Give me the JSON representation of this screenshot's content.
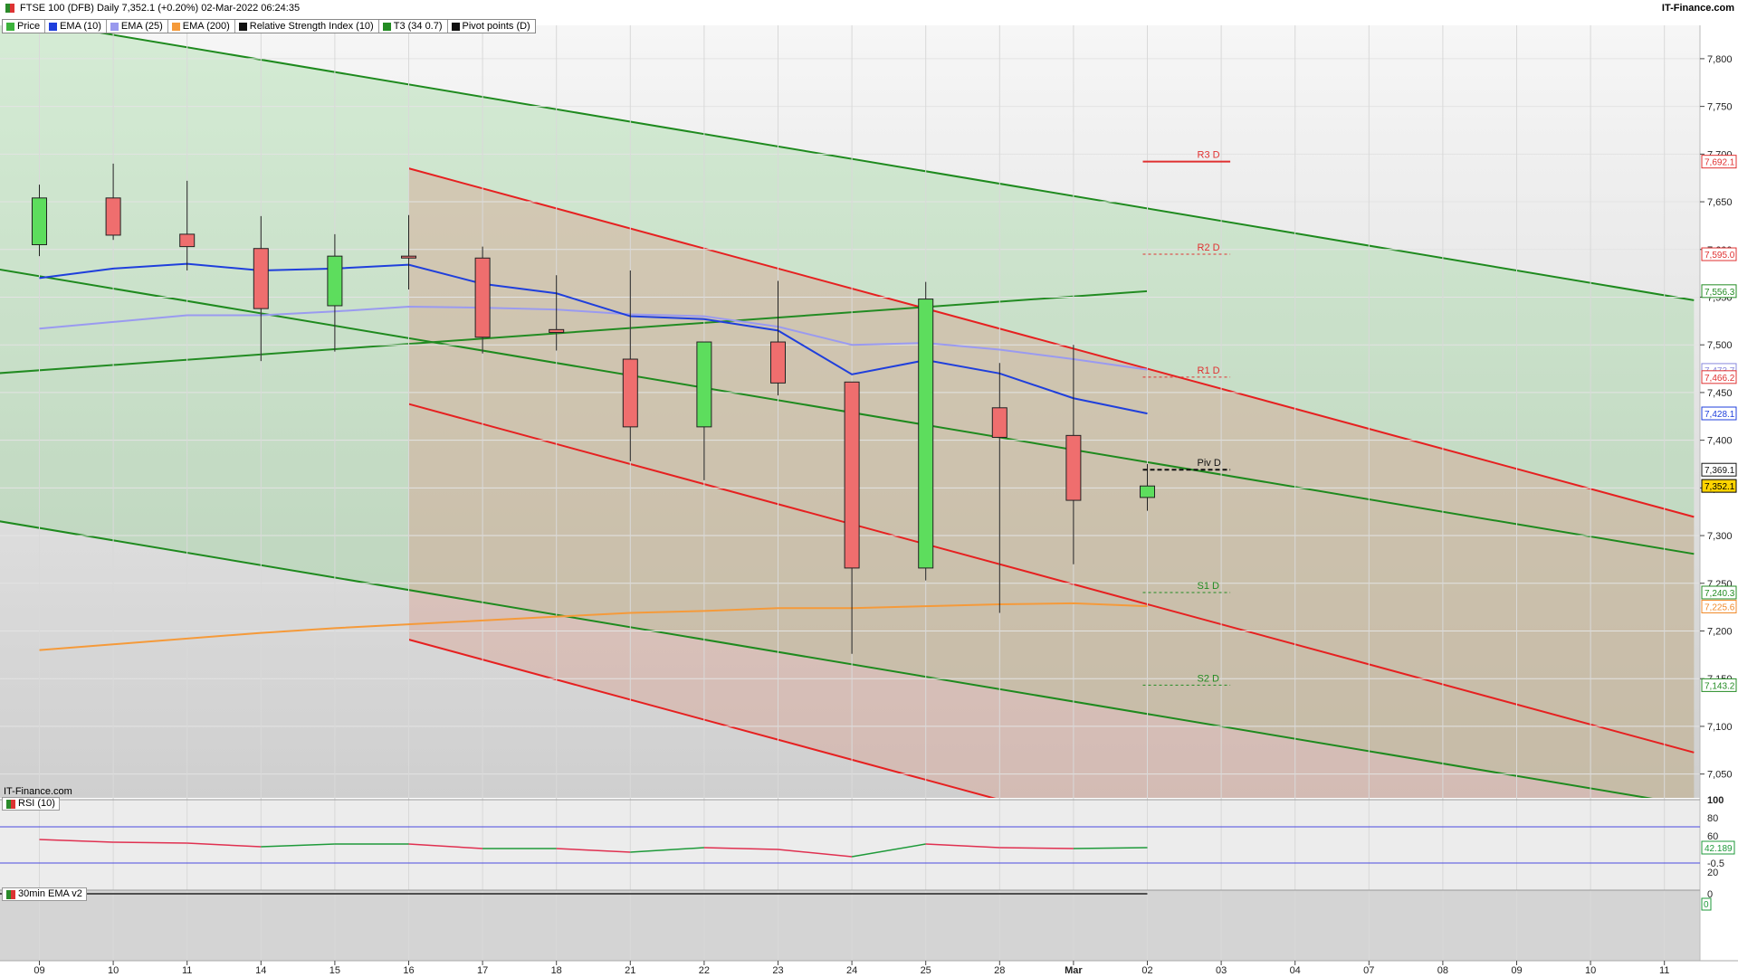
{
  "header": {
    "title": "FTSE 100 (DFB) Daily 7,352.1 (+0.20%) 02-Mar-2022 06:24:35",
    "brand": "IT-Finance.com"
  },
  "legend": [
    {
      "label": "Price",
      "color": "#3cb33c"
    },
    {
      "label": "EMA (10)",
      "color": "#1f3fdc"
    },
    {
      "label": "EMA (25)",
      "color": "#9999ee"
    },
    {
      "label": "EMA (200)",
      "color": "#f59a3a"
    },
    {
      "label": "Relative Strength Index (10)",
      "color": "#111111"
    },
    {
      "label": "T3 (34 0.7)",
      "color": "#228b22"
    },
    {
      "label": "Pivot points (D)",
      "color": "#111111"
    }
  ],
  "footer_brand": "IT-Finance.com",
  "rsi_panel": {
    "label": "RSI (10)",
    "ticks": [
      "100",
      "80",
      "60",
      "20"
    ],
    "value_label": "42.189"
  },
  "ema_panel": {
    "label": "30min EMA v2",
    "ticks": [
      "0",
      "-0.5"
    ],
    "value_label": "0"
  },
  "chart_data": {
    "type": "candlestick",
    "title": "FTSE 100 (DFB) Daily",
    "x_labels": [
      "09",
      "10",
      "11",
      "14",
      "15",
      "16",
      "17",
      "18",
      "21",
      "22",
      "23",
      "24",
      "25",
      "28",
      "Mar",
      "02",
      "03",
      "04",
      "07",
      "08",
      "09",
      "10",
      "11"
    ],
    "candles": [
      {
        "date": "09",
        "open": 7605,
        "high": 7668,
        "low": 7593,
        "close": 7654,
        "dir": "up"
      },
      {
        "date": "10",
        "open": 7654,
        "high": 7690,
        "low": 7610,
        "close": 7615,
        "dir": "down"
      },
      {
        "date": "11",
        "open": 7616,
        "high": 7672,
        "low": 7578,
        "close": 7603,
        "dir": "down"
      },
      {
        "date": "14",
        "open": 7601,
        "high": 7635,
        "low": 7483,
        "close": 7538,
        "dir": "down"
      },
      {
        "date": "15",
        "open": 7541,
        "high": 7616,
        "low": 7493,
        "close": 7593,
        "dir": "up"
      },
      {
        "date": "16",
        "open": 7593,
        "high": 7636,
        "low": 7558,
        "close": 7591,
        "dir": "down"
      },
      {
        "date": "17",
        "open": 7591,
        "high": 7603,
        "low": 7491,
        "close": 7508,
        "dir": "down"
      },
      {
        "date": "18",
        "open": 7516,
        "high": 7573,
        "low": 7494,
        "close": 7513,
        "dir": "down"
      },
      {
        "date": "21",
        "open": 7485,
        "high": 7578,
        "low": 7378,
        "close": 7414,
        "dir": "down"
      },
      {
        "date": "22",
        "open": 7414,
        "high": 7503,
        "low": 7358,
        "close": 7503,
        "dir": "up"
      },
      {
        "date": "23",
        "open": 7503,
        "high": 7567,
        "low": 7447,
        "close": 7460,
        "dir": "down"
      },
      {
        "date": "24",
        "open": 7461,
        "high": 7461,
        "low": 7176,
        "close": 7266,
        "dir": "down"
      },
      {
        "date": "25",
        "open": 7266,
        "high": 7566,
        "low": 7253,
        "close": 7548,
        "dir": "up"
      },
      {
        "date": "28",
        "open": 7434,
        "high": 7481,
        "low": 7219,
        "close": 7403,
        "dir": "down"
      },
      {
        "date": "Mar",
        "open": 7405,
        "high": 7500,
        "low": 7270,
        "close": 7337,
        "dir": "down"
      },
      {
        "date": "02",
        "open": 7340,
        "high": 7375,
        "low": 7326,
        "close": 7352,
        "dir": "up"
      }
    ],
    "ema10": [
      7570,
      7580,
      7585,
      7578,
      7580,
      7584,
      7564,
      7554,
      7530,
      7527,
      7515,
      7469,
      7484,
      7470,
      7444,
      7428
    ],
    "ema25": [
      7517,
      7524,
      7531,
      7531,
      7535,
      7540,
      7539,
      7537,
      7532,
      7530,
      7519,
      7500,
      7502,
      7495,
      7485,
      7474
    ],
    "ema200": [
      7180,
      7186,
      7192,
      7198,
      7203,
      7207,
      7211,
      7215,
      7219,
      7221,
      7224,
      7224,
      7226,
      7228,
      7229,
      7226
    ],
    "t3_value": 7556.3,
    "pivots": {
      "R3 D": 7692.1,
      "R2 D": 7595.0,
      "R1 D": 7466.2,
      "Piv D": 7369.1,
      "S1 D": 7240.3,
      "S2 D": 7143.2
    },
    "price_labels": [
      {
        "value": 7692.1,
        "text": "7,692.1",
        "color": "#e03030",
        "fill": "#ffffff"
      },
      {
        "value": 7595.0,
        "text": "7,595.0",
        "color": "#e03030",
        "fill": "#ffffff"
      },
      {
        "value": 7556.3,
        "text": "7,556.3",
        "color": "#228b22",
        "fill": "#ffffff"
      },
      {
        "value": 7473.7,
        "text": "7,473.7",
        "color": "#8888dd",
        "fill": "#ffffff"
      },
      {
        "value": 7466.2,
        "text": "7,466.2",
        "color": "#e03030",
        "fill": "#ffffff"
      },
      {
        "value": 7428.1,
        "text": "7,428.1",
        "color": "#1f3fdc",
        "fill": "#ffffff"
      },
      {
        "value": 7369.1,
        "text": "7,369.1",
        "color": "#111111",
        "fill": "#ffffff"
      },
      {
        "value": 7352.1,
        "text": "7,352.1",
        "color": "#000000",
        "fill": "#ffd400"
      },
      {
        "value": 7240.3,
        "text": "7,240.3",
        "color": "#228b22",
        "fill": "#ffffff"
      },
      {
        "value": 7225.6,
        "text": "7,225.6",
        "color": "#f08a2a",
        "fill": "#ffffff"
      },
      {
        "value": 7143.2,
        "text": "7,143.2",
        "color": "#228b22",
        "fill": "#ffffff"
      }
    ],
    "y_ticks": [
      7800,
      7750,
      7700,
      7650,
      7600,
      7550,
      7500,
      7450,
      7400,
      7350,
      7300,
      7250,
      7200,
      7150,
      7100,
      7050
    ],
    "y_tick_labels": [
      "7,800",
      "7,750",
      "7,700",
      "7,650",
      "7,600",
      "7,550",
      "7,500",
      "7,450",
      "7,400",
      "7,350",
      "7,300",
      "7,250",
      "7,200",
      "7,150",
      "7,100",
      "7,050"
    ],
    "ylim": [
      7025,
      7835
    ],
    "rsi": [
      56,
      53,
      52,
      48,
      51,
      51,
      46,
      46,
      42,
      47,
      45,
      37,
      51,
      47,
      46,
      47
    ],
    "rsi_levels": [
      70,
      30
    ],
    "ema_bar": {
      "date": "25",
      "value": -0.95
    },
    "colors": {
      "up": "#5ddd5d",
      "down": "#ef6e6e",
      "ema10": "#1f3fdc",
      "ema25": "#9a9af0",
      "ema200": "#f59a3a",
      "t3": "#228b22",
      "channel_red": "#e62020",
      "channel_green": "#1e8a1e"
    }
  }
}
